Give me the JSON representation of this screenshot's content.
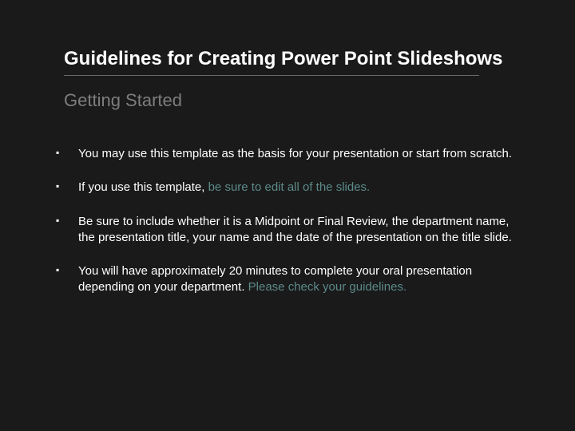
{
  "title": "Guidelines for Creating Power Point Slideshows",
  "subtitle": "Getting Started",
  "bullets": [
    {
      "pre": "You may use this template as the basis for your presentation or start from scratch.",
      "accent": "",
      "post": ""
    },
    {
      "pre": "If you use this template, ",
      "accent": "be sure to edit all of the slides.",
      "post": ""
    },
    {
      "pre": "Be sure to include whether it is a Midpoint or Final Review, the department name, the presentation title, your name and the date of the presentation on the title slide.",
      "accent": "",
      "post": ""
    },
    {
      "pre": "You will have approximately 20 minutes to complete your oral presentation depending on your department. ",
      "accent": "Please check your guidelines.",
      "post": ""
    }
  ]
}
